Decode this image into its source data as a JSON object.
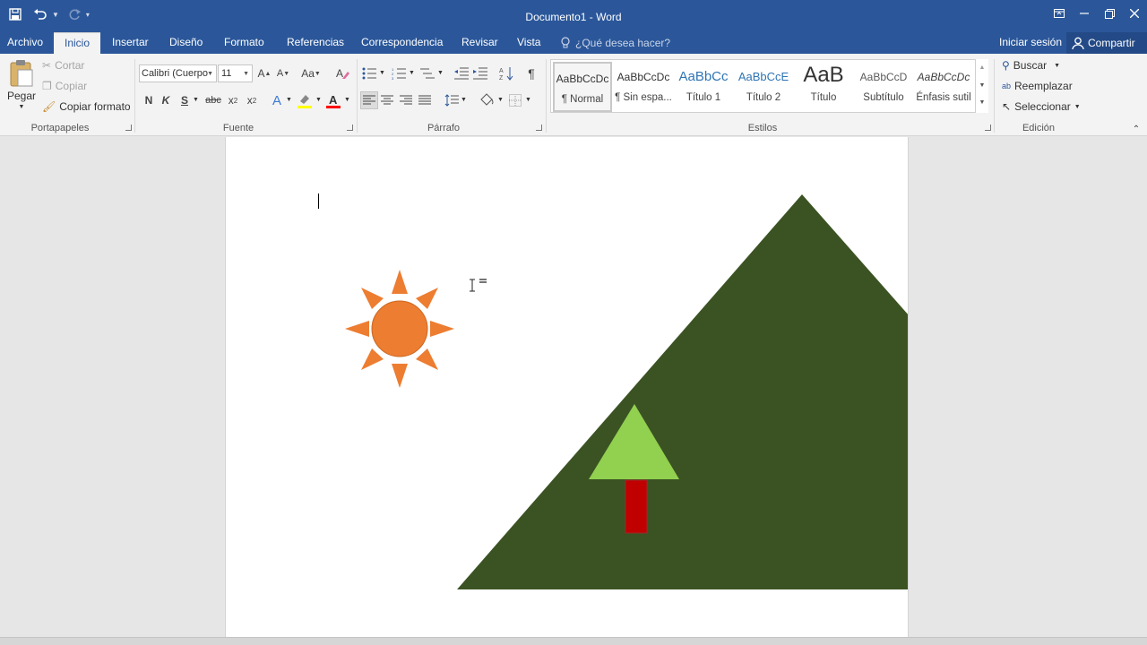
{
  "window": {
    "title": "Documento1 - Word"
  },
  "tabs": {
    "archivo": "Archivo",
    "inicio": "Inicio",
    "insertar": "Insertar",
    "diseno": "Diseño",
    "formato": "Formato",
    "referencias": "Referencias",
    "correspondencia": "Correspondencia",
    "revisar": "Revisar",
    "vista": "Vista"
  },
  "tell_me": "¿Qué desea hacer?",
  "account": {
    "signin": "Iniciar sesión",
    "share": "Compartir"
  },
  "clipboard": {
    "paste": "Pegar",
    "cut": "Cortar",
    "copy": "Copiar",
    "format_painter": "Copiar formato",
    "label": "Portapapeles"
  },
  "font": {
    "name": "Calibri (Cuerpo",
    "size": "11",
    "case_btn": "Aa",
    "bold": "N",
    "italic": "K",
    "underline": "S",
    "strike": "abc",
    "label": "Fuente"
  },
  "paragraph": {
    "label": "Párrafo"
  },
  "styles": {
    "label": "Estilos",
    "items": [
      {
        "sample": "AaBbCcDc",
        "name": "¶ Normal"
      },
      {
        "sample": "AaBbCcDc",
        "name": "¶ Sin espa..."
      },
      {
        "sample": "AaBbCc",
        "name": "Título 1"
      },
      {
        "sample": "AaBbCcE",
        "name": "Título 2"
      },
      {
        "sample": "AaB",
        "name": "Título"
      },
      {
        "sample": "AaBbCcD",
        "name": "Subtítulo"
      },
      {
        "sample": "AaBbCcDc",
        "name": "Énfasis sutil"
      }
    ]
  },
  "editing": {
    "find": "Buscar",
    "replace": "Reemplazar",
    "select": "Seleccionar",
    "label": "Edición"
  },
  "colors": {
    "brand": "#2b579a",
    "sun": "#ed7d31",
    "mountain": "#3b5323",
    "tree_top": "#92d050",
    "trunk": "#c00000",
    "highlight": "#ffff00",
    "font_color": "#ff0000"
  }
}
